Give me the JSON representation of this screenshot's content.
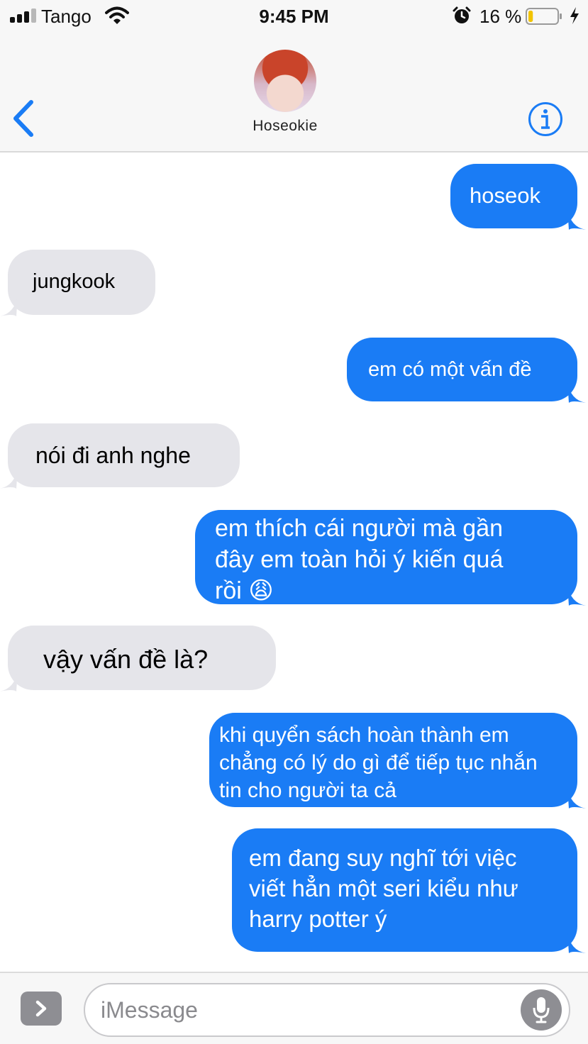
{
  "status_bar": {
    "carrier": "Tango",
    "time": "9:45 PM",
    "battery_percent": "16 %",
    "battery_level": 0.16,
    "icons": [
      "signal-icon",
      "wifi-icon",
      "alarm-icon",
      "battery-icon",
      "charging-bolt-icon"
    ]
  },
  "nav": {
    "contact_name": "Hoseokie",
    "back_icon": "chevron-left-icon",
    "info_icon": "info-icon",
    "accent_color": "#1a7cf5"
  },
  "messages": [
    {
      "direction": "out",
      "text": "hoseok"
    },
    {
      "direction": "in",
      "text": "jungkook"
    },
    {
      "direction": "out",
      "text": "em có một vấn đề"
    },
    {
      "direction": "in",
      "text": "nói đi anh nghe"
    },
    {
      "direction": "out",
      "text": "em thích cái người mà gần\nđây em toàn hỏi ý kiến quá\nrồi 😩"
    },
    {
      "direction": "in",
      "text": "vậy vấn đề là?"
    },
    {
      "direction": "out",
      "text": "khi quyển sách hoàn thành em\nchẳng có lý do gì để tiếp tục nhắn\ntin cho người ta cả"
    },
    {
      "direction": "out",
      "text": "em đang suy nghĩ tới việc\nviết hẳn một seri kiểu như\nharry potter ý"
    }
  ],
  "composer": {
    "placeholder": "iMessage",
    "apps_icon": "chevron-right-icon",
    "mic_icon": "microphone-icon"
  },
  "colors": {
    "outgoing_bubble": "#1a7cf5",
    "incoming_bubble": "#e5e5ea",
    "header_bg": "#f7f7f7"
  }
}
